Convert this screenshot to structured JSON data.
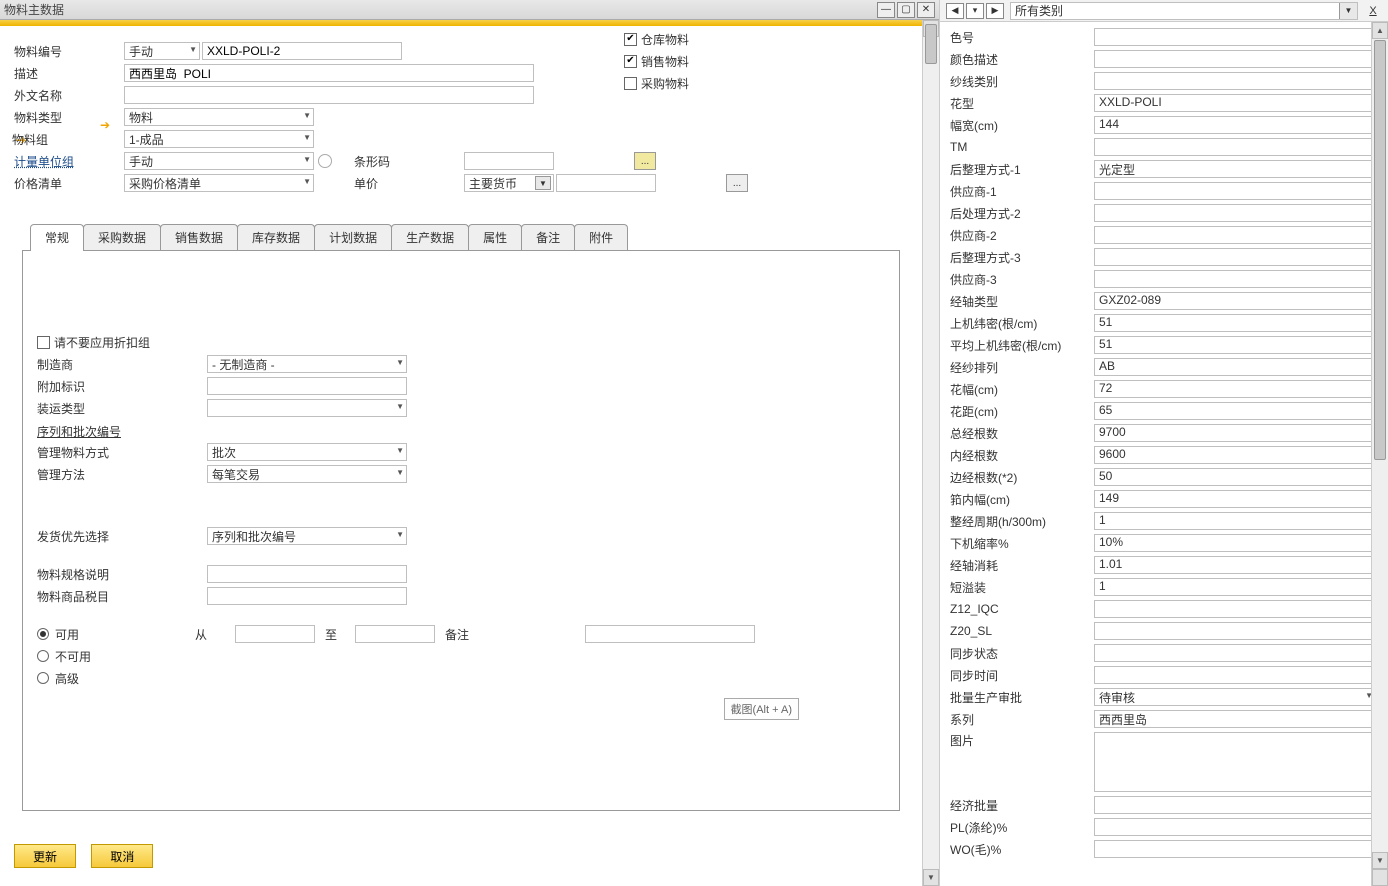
{
  "window": {
    "title": "物料主数据"
  },
  "form": {
    "labels": {
      "material_no": "物料编号",
      "desc": "描述",
      "foreign_name": "外文名称",
      "material_type": "物料类型",
      "material_group": "物料组",
      "uom_group": "计量单位组",
      "price_list": "价格清单",
      "barcode": "条形码",
      "unit_price": "单价"
    },
    "material_no_mode": "手动",
    "material_no": "XXLD-POLI-2",
    "desc": "西西里岛  POLI",
    "foreign_name": "",
    "material_type": "物料",
    "material_group": "1-成品",
    "uom_group": "手动",
    "price_list": "采购价格清单",
    "barcode": "",
    "unit_price_currency": "主要货币",
    "unit_price": "",
    "checks": {
      "warehouse": "仓库物料",
      "sales": "销售物料",
      "purchase": "采购物料"
    }
  },
  "tabs": [
    "常规",
    "采购数据",
    "销售数据",
    "库存数据",
    "计划数据",
    "生产数据",
    "属性",
    "备注",
    "附件"
  ],
  "general": {
    "no_discount_group": "请不要应用折扣组",
    "labels": {
      "manufacturer": "制造商",
      "addl_id": "附加标识",
      "ship_type": "装运类型",
      "serial_section": "序列和批次编号",
      "manage_by": "管理物料方式",
      "manage_method": "管理方法",
      "ship_priority": "发货优先选择",
      "spec_desc": "物料规格说明",
      "tax_item": "物料商品税目",
      "from": "从",
      "to": "至",
      "remark": "备注"
    },
    "manufacturer": "- 无制造商 -",
    "addl_id": "",
    "ship_type": "",
    "manage_by": "批次",
    "manage_method": "每笔交易",
    "ship_priority": "序列和批次编号",
    "spec_desc": "",
    "tax_item": "",
    "radios": {
      "available": "可用",
      "unavailable": "不可用",
      "advanced": "高级"
    },
    "from": "",
    "to": "",
    "remark": ""
  },
  "buttons": {
    "update": "更新",
    "cancel": "取消"
  },
  "tooltip": "截图(Alt + A)",
  "right": {
    "dropdown": "所有类别",
    "attrs": [
      {
        "label": "色号",
        "value": ""
      },
      {
        "label": "颜色描述",
        "value": ""
      },
      {
        "label": "纱线类别",
        "value": ""
      },
      {
        "label": "花型",
        "value": "XXLD-POLI"
      },
      {
        "label": "幅宽(cm)",
        "value": "144"
      },
      {
        "label": "TM",
        "value": ""
      },
      {
        "label": "后整理方式-1",
        "value": "光定型"
      },
      {
        "label": "供应商-1",
        "value": ""
      },
      {
        "label": "后处理方式-2",
        "value": ""
      },
      {
        "label": "供应商-2",
        "value": ""
      },
      {
        "label": "后整理方式-3",
        "value": ""
      },
      {
        "label": "供应商-3",
        "value": ""
      },
      {
        "label": "经轴类型",
        "value": "GXZ02-089"
      },
      {
        "label": "上机纬密(根/cm)",
        "value": "51"
      },
      {
        "label": "平均上机纬密(根/cm)",
        "value": "51"
      },
      {
        "label": "经纱排列",
        "value": "AB"
      },
      {
        "label": "花幅(cm)",
        "value": "72"
      },
      {
        "label": "花距(cm)",
        "value": "65"
      },
      {
        "label": "总经根数",
        "value": "9700"
      },
      {
        "label": "内经根数",
        "value": "9600"
      },
      {
        "label": "边经根数(*2)",
        "value": "50"
      },
      {
        "label": "筘内幅(cm)",
        "value": "149"
      },
      {
        "label": "整经周期(h/300m)",
        "value": "1"
      },
      {
        "label": "下机缩率%",
        "value": "10%"
      },
      {
        "label": "经轴消耗",
        "value": "1.01"
      },
      {
        "label": "短溢装",
        "value": "1"
      },
      {
        "label": "Z12_IQC",
        "value": ""
      },
      {
        "label": "Z20_SL",
        "value": ""
      },
      {
        "label": "同步状态",
        "value": ""
      },
      {
        "label": "同步时间",
        "value": ""
      },
      {
        "label": "批量生产审批",
        "value": "待审核",
        "dropdown": true
      },
      {
        "label": "系列",
        "value": "西西里岛"
      },
      {
        "label": "图片",
        "value": "",
        "big": true
      },
      {
        "label": "经济批量",
        "value": ""
      },
      {
        "label": "PL(涤纶)%",
        "value": ""
      },
      {
        "label": "WO(毛)%",
        "value": ""
      }
    ]
  }
}
